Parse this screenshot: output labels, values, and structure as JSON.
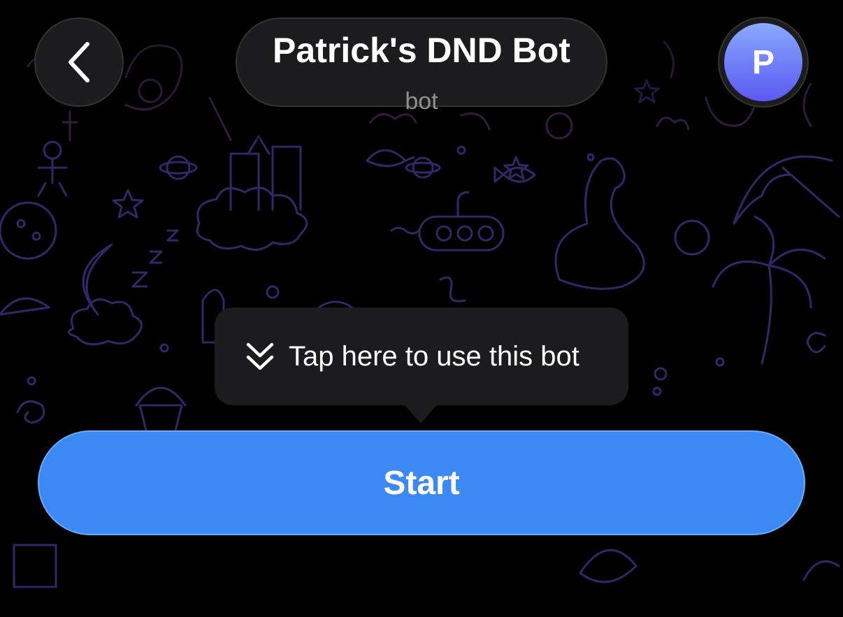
{
  "header": {
    "back_icon": "chevron-left-icon",
    "title": "Patrick's DND Bot",
    "subtitle": "bot",
    "avatar_initial": "P",
    "avatar_gradient": [
      "#8aa9ff",
      "#5a58f2"
    ]
  },
  "tooltip": {
    "icon": "double-chevron-down-icon",
    "text": "Tap here to use this bot"
  },
  "start_button": {
    "label": "Start",
    "color": "#3d89f3"
  },
  "background": {
    "pattern": "doodle-wallpaper",
    "base_color": "#000000",
    "doodle_colors": [
      "#3a2a7a",
      "#4a2f6a",
      "#2c3a7a"
    ]
  }
}
